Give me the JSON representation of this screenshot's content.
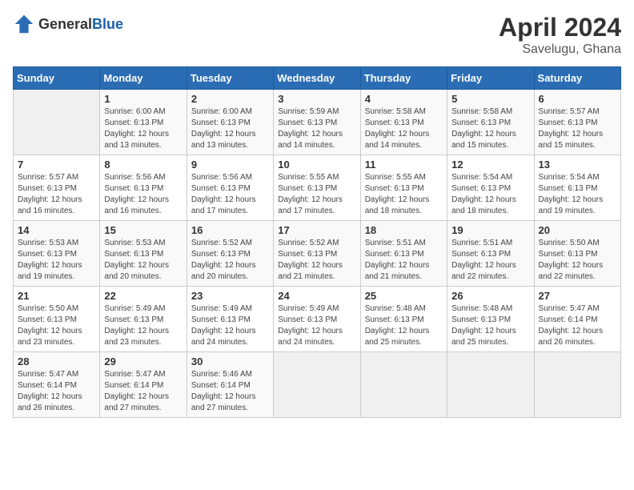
{
  "header": {
    "logo": {
      "general": "General",
      "blue": "Blue"
    },
    "title": "April 2024",
    "subtitle": "Savelugu, Ghana"
  },
  "columns": [
    "Sunday",
    "Monday",
    "Tuesday",
    "Wednesday",
    "Thursday",
    "Friday",
    "Saturday"
  ],
  "weeks": [
    [
      {
        "day": "",
        "info": ""
      },
      {
        "day": "1",
        "info": "Sunrise: 6:00 AM\nSunset: 6:13 PM\nDaylight: 12 hours\nand 13 minutes."
      },
      {
        "day": "2",
        "info": "Sunrise: 6:00 AM\nSunset: 6:13 PM\nDaylight: 12 hours\nand 13 minutes."
      },
      {
        "day": "3",
        "info": "Sunrise: 5:59 AM\nSunset: 6:13 PM\nDaylight: 12 hours\nand 14 minutes."
      },
      {
        "day": "4",
        "info": "Sunrise: 5:58 AM\nSunset: 6:13 PM\nDaylight: 12 hours\nand 14 minutes."
      },
      {
        "day": "5",
        "info": "Sunrise: 5:58 AM\nSunset: 6:13 PM\nDaylight: 12 hours\nand 15 minutes."
      },
      {
        "day": "6",
        "info": "Sunrise: 5:57 AM\nSunset: 6:13 PM\nDaylight: 12 hours\nand 15 minutes."
      }
    ],
    [
      {
        "day": "7",
        "info": "Sunrise: 5:57 AM\nSunset: 6:13 PM\nDaylight: 12 hours\nand 16 minutes."
      },
      {
        "day": "8",
        "info": "Sunrise: 5:56 AM\nSunset: 6:13 PM\nDaylight: 12 hours\nand 16 minutes."
      },
      {
        "day": "9",
        "info": "Sunrise: 5:56 AM\nSunset: 6:13 PM\nDaylight: 12 hours\nand 17 minutes."
      },
      {
        "day": "10",
        "info": "Sunrise: 5:55 AM\nSunset: 6:13 PM\nDaylight: 12 hours\nand 17 minutes."
      },
      {
        "day": "11",
        "info": "Sunrise: 5:55 AM\nSunset: 6:13 PM\nDaylight: 12 hours\nand 18 minutes."
      },
      {
        "day": "12",
        "info": "Sunrise: 5:54 AM\nSunset: 6:13 PM\nDaylight: 12 hours\nand 18 minutes."
      },
      {
        "day": "13",
        "info": "Sunrise: 5:54 AM\nSunset: 6:13 PM\nDaylight: 12 hours\nand 19 minutes."
      }
    ],
    [
      {
        "day": "14",
        "info": "Sunrise: 5:53 AM\nSunset: 6:13 PM\nDaylight: 12 hours\nand 19 minutes."
      },
      {
        "day": "15",
        "info": "Sunrise: 5:53 AM\nSunset: 6:13 PM\nDaylight: 12 hours\nand 20 minutes."
      },
      {
        "day": "16",
        "info": "Sunrise: 5:52 AM\nSunset: 6:13 PM\nDaylight: 12 hours\nand 20 minutes."
      },
      {
        "day": "17",
        "info": "Sunrise: 5:52 AM\nSunset: 6:13 PM\nDaylight: 12 hours\nand 21 minutes."
      },
      {
        "day": "18",
        "info": "Sunrise: 5:51 AM\nSunset: 6:13 PM\nDaylight: 12 hours\nand 21 minutes."
      },
      {
        "day": "19",
        "info": "Sunrise: 5:51 AM\nSunset: 6:13 PM\nDaylight: 12 hours\nand 22 minutes."
      },
      {
        "day": "20",
        "info": "Sunrise: 5:50 AM\nSunset: 6:13 PM\nDaylight: 12 hours\nand 22 minutes."
      }
    ],
    [
      {
        "day": "21",
        "info": "Sunrise: 5:50 AM\nSunset: 6:13 PM\nDaylight: 12 hours\nand 23 minutes."
      },
      {
        "day": "22",
        "info": "Sunrise: 5:49 AM\nSunset: 6:13 PM\nDaylight: 12 hours\nand 23 minutes."
      },
      {
        "day": "23",
        "info": "Sunrise: 5:49 AM\nSunset: 6:13 PM\nDaylight: 12 hours\nand 24 minutes."
      },
      {
        "day": "24",
        "info": "Sunrise: 5:49 AM\nSunset: 6:13 PM\nDaylight: 12 hours\nand 24 minutes."
      },
      {
        "day": "25",
        "info": "Sunrise: 5:48 AM\nSunset: 6:13 PM\nDaylight: 12 hours\nand 25 minutes."
      },
      {
        "day": "26",
        "info": "Sunrise: 5:48 AM\nSunset: 6:13 PM\nDaylight: 12 hours\nand 25 minutes."
      },
      {
        "day": "27",
        "info": "Sunrise: 5:47 AM\nSunset: 6:14 PM\nDaylight: 12 hours\nand 26 minutes."
      }
    ],
    [
      {
        "day": "28",
        "info": "Sunrise: 5:47 AM\nSunset: 6:14 PM\nDaylight: 12 hours\nand 26 minutes."
      },
      {
        "day": "29",
        "info": "Sunrise: 5:47 AM\nSunset: 6:14 PM\nDaylight: 12 hours\nand 27 minutes."
      },
      {
        "day": "30",
        "info": "Sunrise: 5:46 AM\nSunset: 6:14 PM\nDaylight: 12 hours\nand 27 minutes."
      },
      {
        "day": "",
        "info": ""
      },
      {
        "day": "",
        "info": ""
      },
      {
        "day": "",
        "info": ""
      },
      {
        "day": "",
        "info": ""
      }
    ]
  ]
}
